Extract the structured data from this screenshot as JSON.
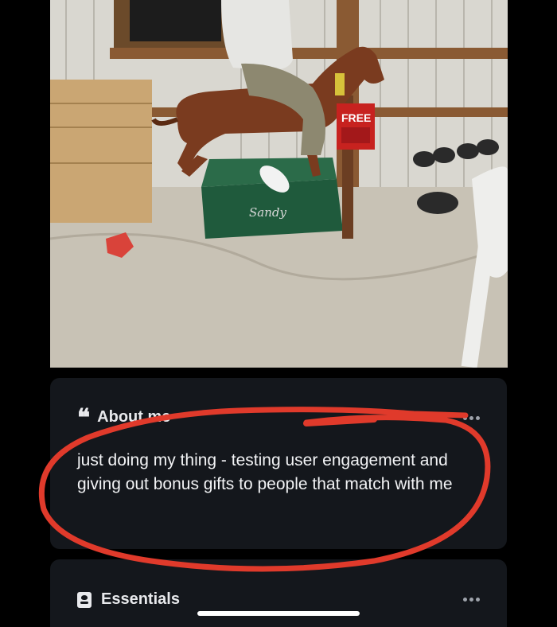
{
  "photo": {
    "sign_free": "FREE",
    "base_label": "Sandy"
  },
  "about": {
    "title": "About me",
    "quote_glyph": "❝",
    "text": "just doing my thing - testing user engagement and giving out bonus gifts to people that match with me"
  },
  "essentials": {
    "title": "Essentials"
  },
  "colors": {
    "background": "#000000",
    "card": "#14171c",
    "text": "#f2f3f5",
    "annotation": "#e03a2b"
  },
  "icons": {
    "quote": "quote-icon",
    "more": "more-dots-icon",
    "essentials": "id-card-icon"
  }
}
